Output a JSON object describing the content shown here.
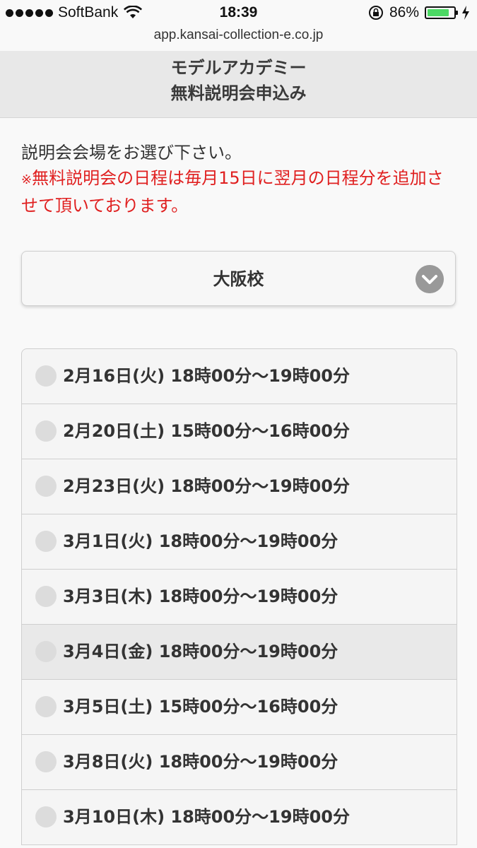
{
  "status_bar": {
    "carrier": "SoftBank",
    "time": "18:39",
    "battery_text": "86%",
    "battery_level": 0.86,
    "battery_color": "#4cd964"
  },
  "url_bar": {
    "url": "app.kansai-collection-e.co.jp"
  },
  "header": {
    "title_line1": "モデルアカデミー",
    "title_line2": "無料説明会申込み"
  },
  "intro": {
    "instruction": "説明会会場をお選び下さい。",
    "note_mark": "※",
    "note": "無料説明会の日程は毎月15日に翌月の日程分を追加させて頂いております。",
    "note_color": "#e02020"
  },
  "venue_select": {
    "selected": "大阪校",
    "icon": "chevron-down-icon"
  },
  "sessions": [
    {
      "label": "2月16日(火) 18時00分〜19時00分",
      "selected": false
    },
    {
      "label": "2月20日(土) 15時00分〜16時00分",
      "selected": false
    },
    {
      "label": "2月23日(火) 18時00分〜19時00分",
      "selected": false
    },
    {
      "label": "3月1日(火) 18時00分〜19時00分",
      "selected": false
    },
    {
      "label": "3月3日(木) 18時00分〜19時00分",
      "selected": false
    },
    {
      "label": "3月4日(金) 18時00分〜19時00分",
      "selected": false
    },
    {
      "label": "3月5日(土) 15時00分〜16時00分",
      "selected": false
    },
    {
      "label": "3月8日(火) 18時00分〜19時00分",
      "selected": false
    },
    {
      "label": "3月10日(木) 18時00分〜19時00分",
      "selected": false
    }
  ]
}
